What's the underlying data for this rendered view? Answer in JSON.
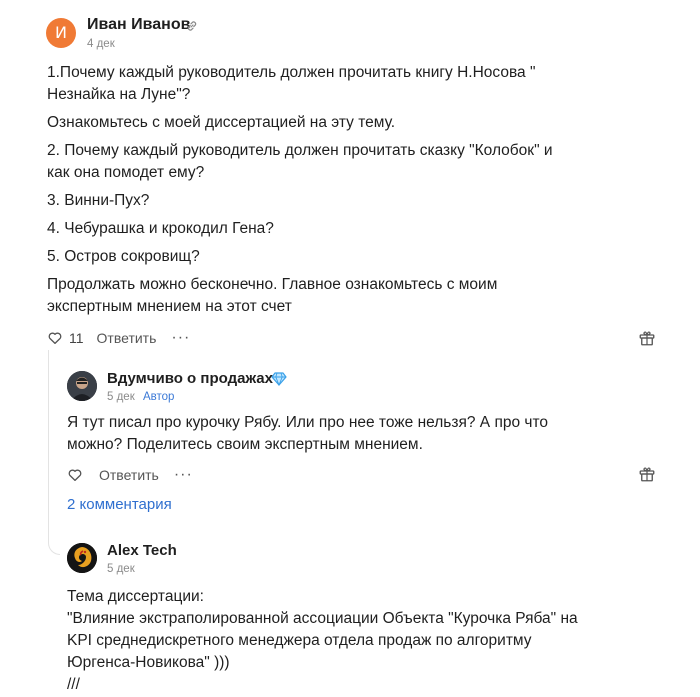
{
  "comment1": {
    "avatar_letter": "И",
    "author": "Иван Иванов",
    "date": "4 дек",
    "paragraphs": [
      "1.Почему каждый руководитель должен прочитать книгу Н.Носова \" Незнайка на Луне\"?",
      "Ознакомьтесь с моей диссертацией на эту тему.",
      "2. Почему каждый руководитель должен прочитать сказку \"Колобок\" и как она помодет ему?",
      "3. Винни-Пух?",
      "4. Чебурашка и крокодил Гена?",
      "5. Остров сокровищ?",
      "Продолжать можно бесконечно. Главное ознакомьтесь с моим экспертным мнением на этот счет"
    ],
    "likes": "11",
    "reply_label": "Ответить",
    "more_label": "···"
  },
  "comment2": {
    "author": "Вдумчиво о продажах",
    "date": "5 дек",
    "badge": "Автор",
    "text": "Я тут писал про курочку Рябу. Или про нее тоже нельзя? А про что можно? Поделитесь своим экспертным мнением.",
    "reply_label": "Ответить",
    "more_label": "···"
  },
  "thread": {
    "more_comments": "2 комментария"
  },
  "comment3": {
    "author": "Alex Tech",
    "date": "5 дек",
    "lines": [
      "Тема диссертации:",
      "\"Влияние экстраполированной ассоциации Объекта \"Курочка Ряба\" на",
      "KPI среднедискретного менеджера отдела продаж по алгоритму",
      "Юргенса-Новикова\" )))",
      "///"
    ]
  },
  "colors": {
    "avatar_bg": "#f07a35",
    "link": "#2f6fcf",
    "badge": "#3b79d6"
  }
}
